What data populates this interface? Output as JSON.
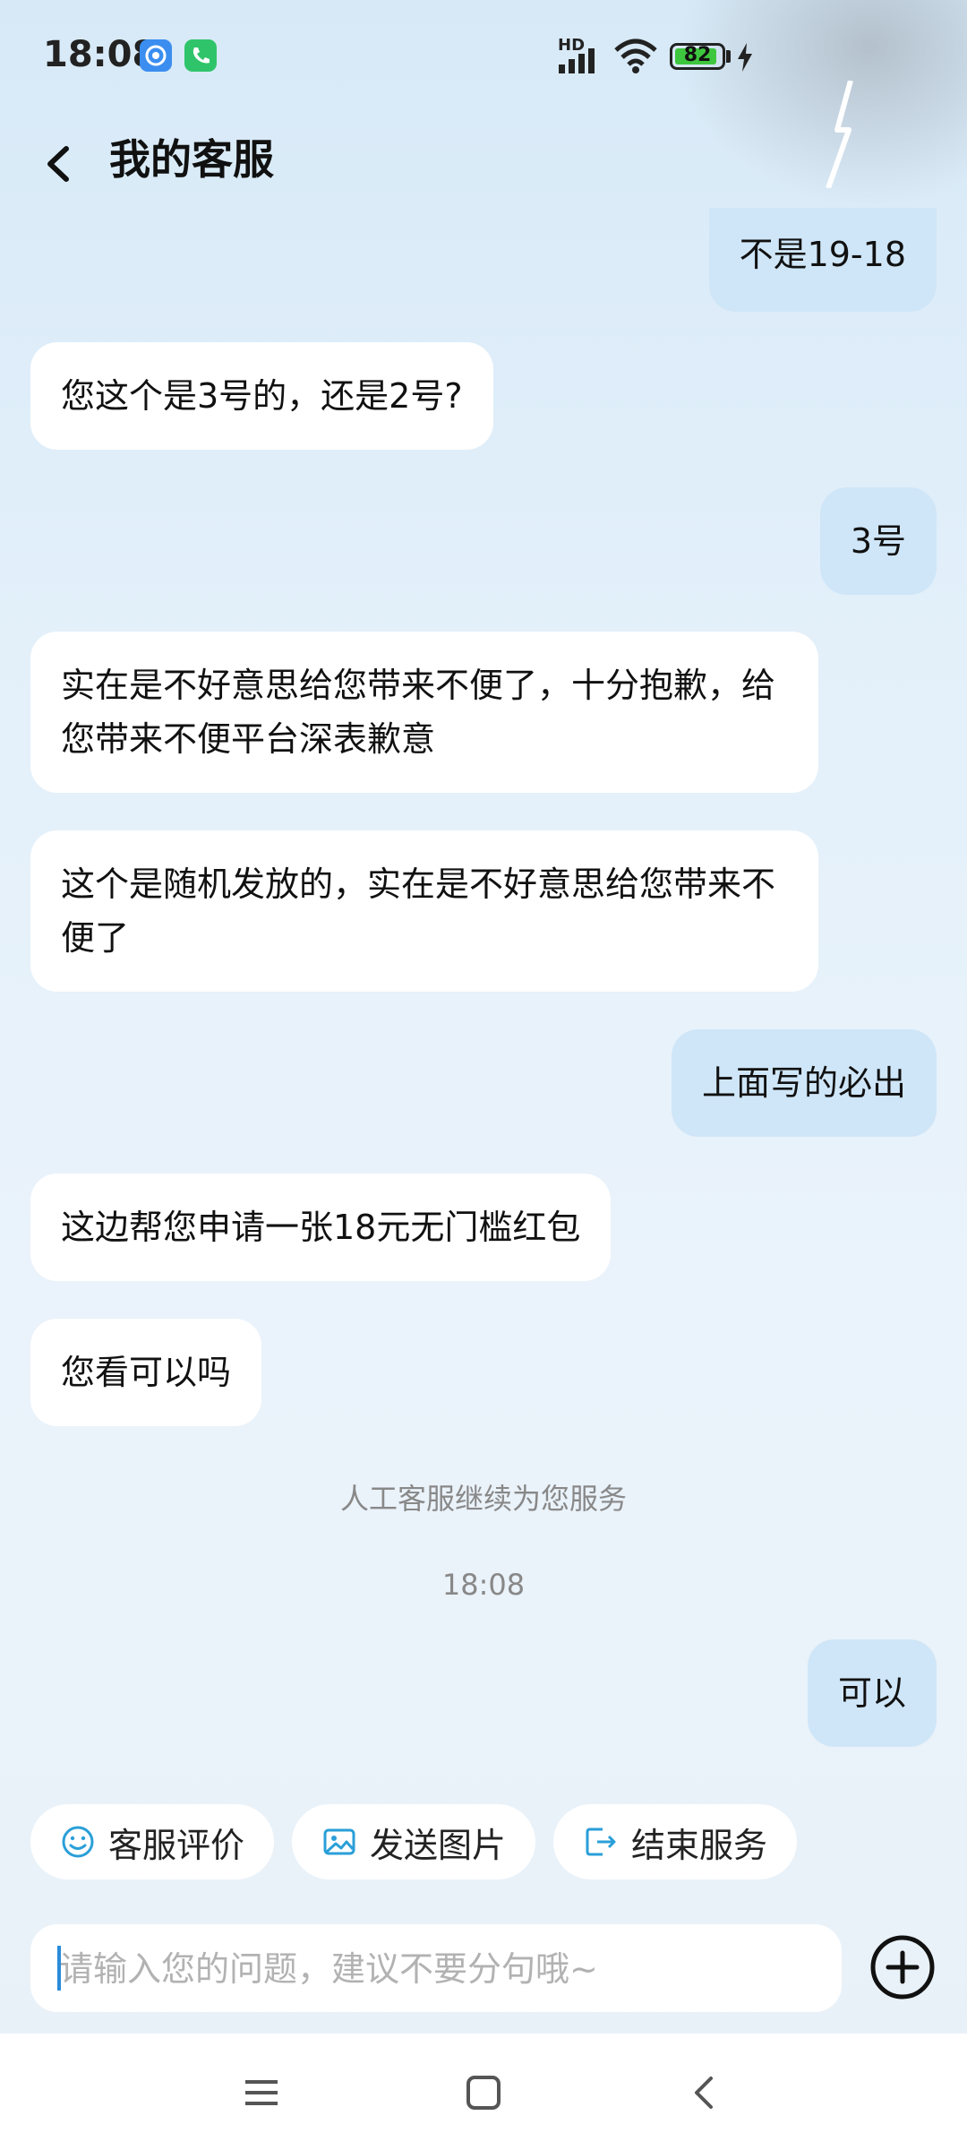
{
  "status_bar": {
    "time": "18:08",
    "network_label": "HD",
    "battery_level": "82",
    "icons": [
      "notification-app-icon",
      "phone-call-icon",
      "signal-icon",
      "wifi-icon",
      "battery-icon",
      "charging-icon"
    ]
  },
  "header": {
    "back_icon": "back-arrow-icon",
    "title": "我的客服"
  },
  "messages": [
    {
      "side": "right",
      "text": "不是19-18"
    },
    {
      "side": "left",
      "text": "您这个是3号的，还是2号?"
    },
    {
      "side": "right",
      "text": "3号"
    },
    {
      "side": "left",
      "text": "实在是不好意思给您带来不便了，十分抱歉，给您带来不便平台深表歉意"
    },
    {
      "side": "left",
      "text": "这个是随机发放的，实在是不好意思给您带来不便了"
    },
    {
      "side": "right",
      "text": "上面写的必出"
    },
    {
      "side": "left",
      "text": "这边帮您申请一张18元无门槛红包"
    },
    {
      "side": "left",
      "text": "您看可以吗"
    },
    {
      "side": "right",
      "text": "可以"
    }
  ],
  "system": {
    "notice": "人工客服继续为您服务",
    "timestamp": "18:08"
  },
  "actions": [
    {
      "label": "客服评价",
      "icon": "smiley-icon"
    },
    {
      "label": "发送图片",
      "icon": "image-icon"
    },
    {
      "label": "结束服务",
      "icon": "exit-icon"
    }
  ],
  "input": {
    "value": "",
    "placeholder": "请输入您的问题，建议不要分句哦~",
    "plus_icon": "plus-circle-icon"
  },
  "nav": [
    "menu-icon",
    "home-icon",
    "back-icon"
  ],
  "colors": {
    "accent": "#2a9fd8",
    "user_bubble": "#cfe6f8",
    "agent_bubble": "#ffffff",
    "battery": "#3ec63e"
  }
}
